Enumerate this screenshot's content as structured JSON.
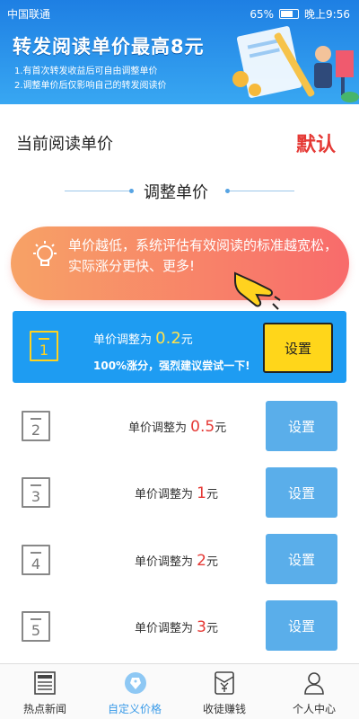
{
  "status_bar": {
    "carrier": "中国联通",
    "battery": "65%",
    "time": "晚上9:56"
  },
  "banner": {
    "title": "转发阅读单价最高8元",
    "line1": "1.有首次转发收益后可自由调整单价",
    "line2": "2.调整单价后仅影响自己的转发阅读价"
  },
  "current": {
    "label": "当前阅读单价",
    "value": "默认"
  },
  "section_title": "调整单价",
  "tip": {
    "text": "单价越低，系统评估有效阅读的标准越宽松，实际涨分更快、更多!"
  },
  "options": [
    {
      "num": "1",
      "prefix": "单价调整为",
      "value": "0.2",
      "unit": "元",
      "promo": "100%涨分，强烈建议尝试一下!",
      "button": "设置",
      "selected": true
    },
    {
      "num": "2",
      "prefix": "单价调整为",
      "value": "0.5",
      "unit": "元",
      "button": "设置"
    },
    {
      "num": "3",
      "prefix": "单价调整为",
      "value": "1",
      "unit": "元",
      "button": "设置"
    },
    {
      "num": "4",
      "prefix": "单价调整为",
      "value": "2",
      "unit": "元",
      "button": "设置"
    },
    {
      "num": "5",
      "prefix": "单价调整为",
      "value": "3",
      "unit": "元",
      "button": "设置"
    }
  ],
  "nav": [
    {
      "label": "热点新闻",
      "icon": "newspaper-icon"
    },
    {
      "label": "自定义价格",
      "icon": "tag-icon",
      "active": true
    },
    {
      "label": "收徒赚钱",
      "icon": "money-envelope-icon"
    },
    {
      "label": "个人中心",
      "icon": "user-icon"
    }
  ],
  "colors": {
    "accent_blue": "#1e9cf2",
    "button_blue": "#5aaeea",
    "highlight_yellow": "#ffd61a",
    "price_red": "#e53935"
  }
}
